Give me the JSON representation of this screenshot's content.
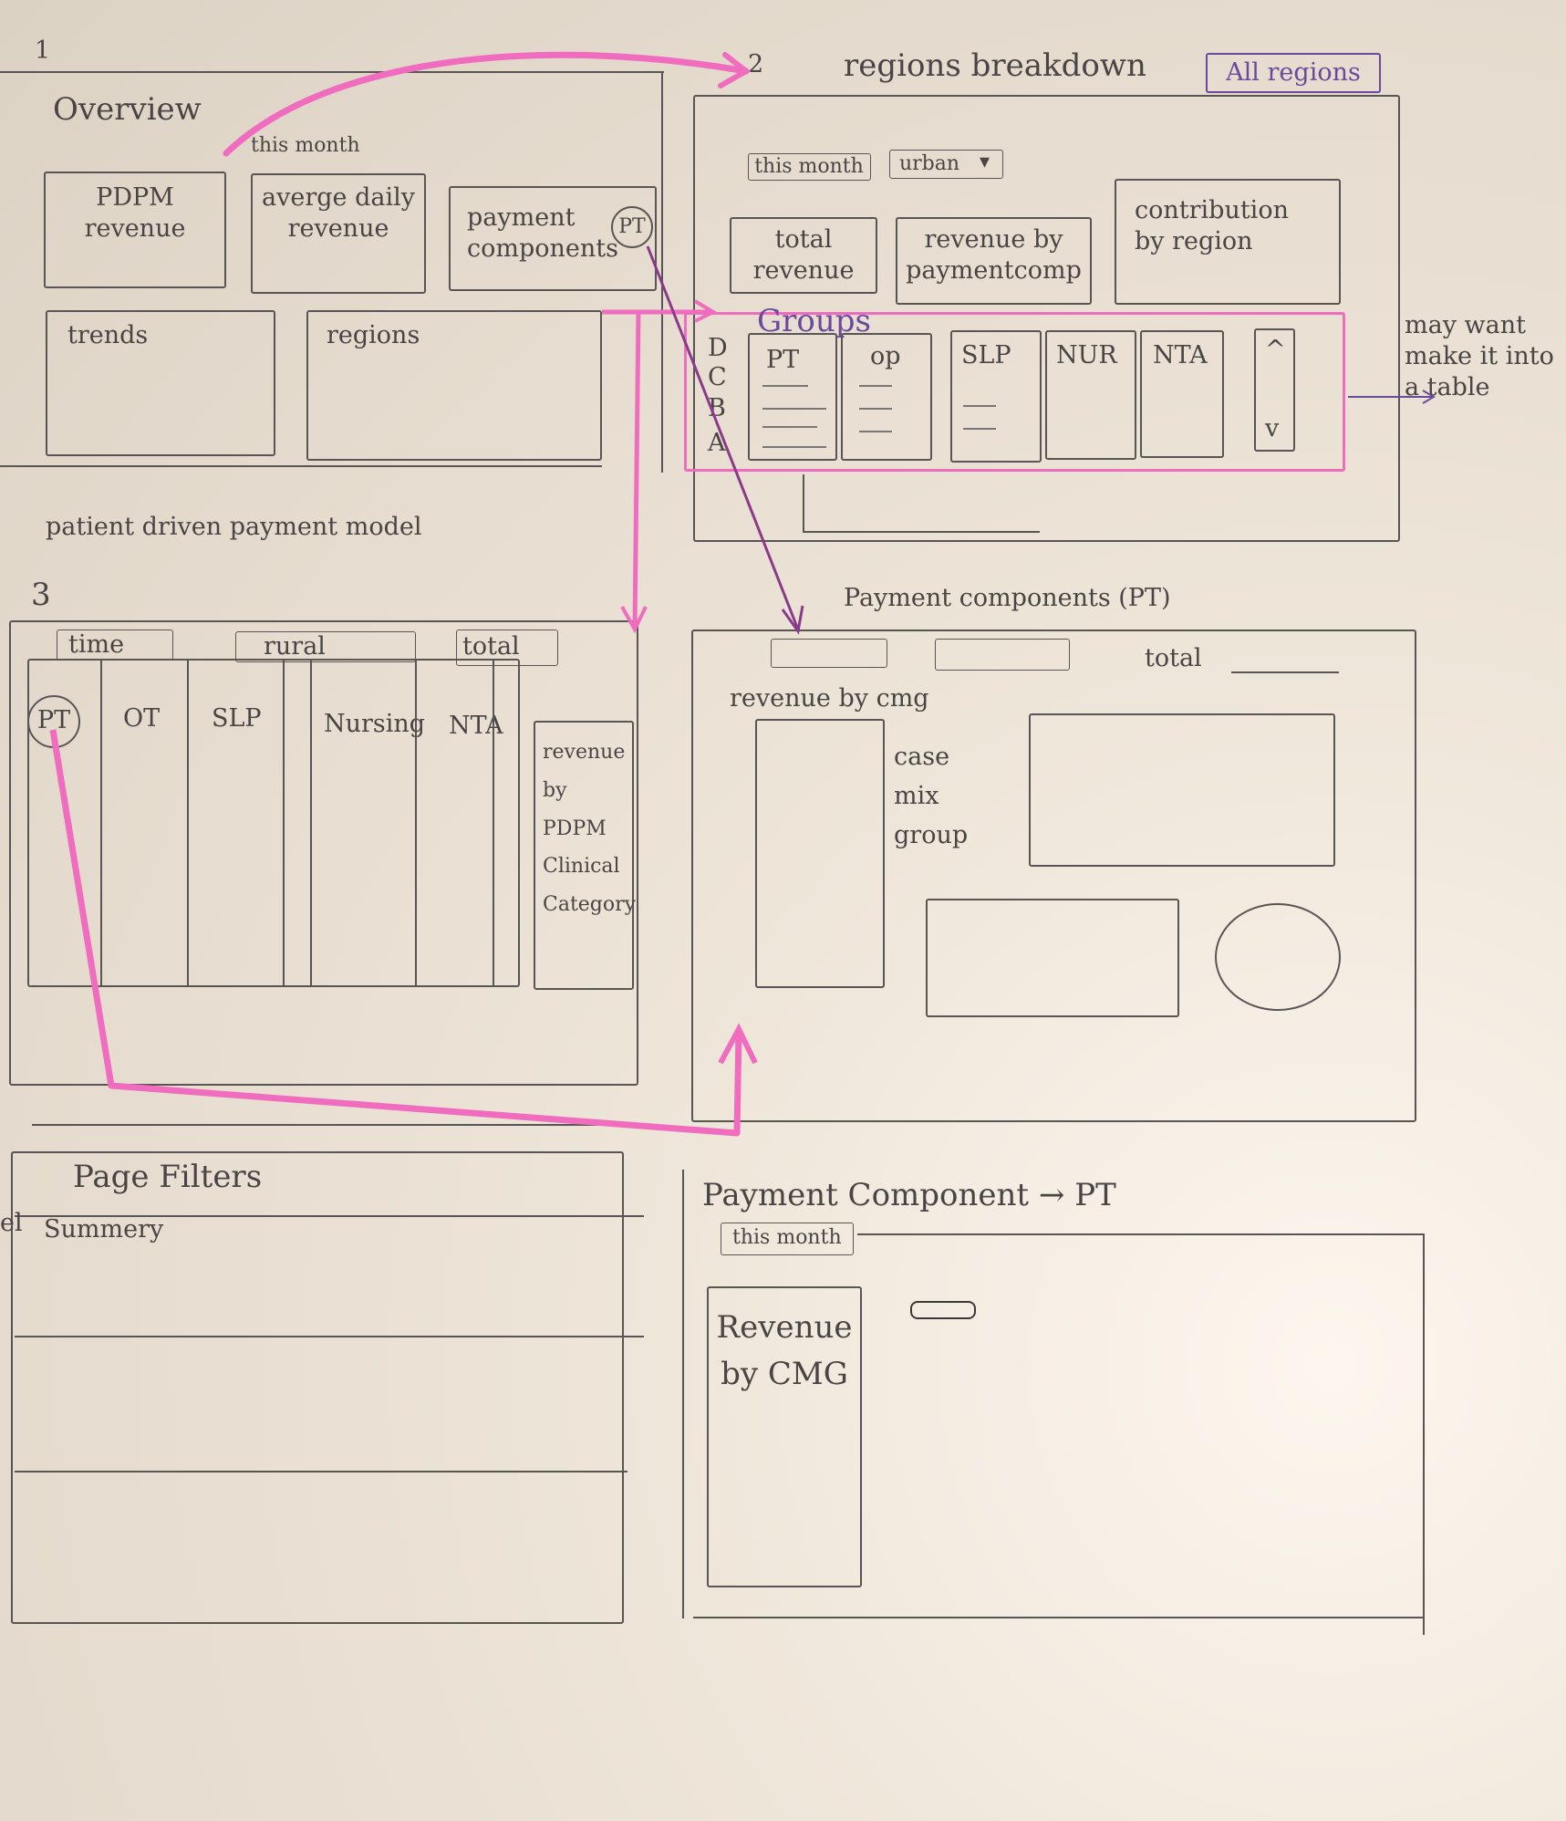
{
  "sketch": {
    "section1": {
      "number": "1",
      "title": "Overview",
      "period": "this month",
      "cards": {
        "pdpm": "PDPM revenue",
        "avg_daily": "averge daily revenue",
        "payment": "payment components",
        "payment_badge": "PT",
        "trends": "trends",
        "regions": "regions"
      },
      "caption": "patient driven payment model"
    },
    "section2": {
      "number": "2",
      "title": "regions breakdown",
      "region_button": "All regions",
      "filter_month": "this month",
      "filter_urban": "urban",
      "cards": {
        "total_revenue": "total revenue",
        "revenue_by_component": "revenue by paymentcomp",
        "contribution": "contribution by region"
      },
      "groups_label": "Groups",
      "row_labels": [
        "D",
        "C",
        "B",
        "A"
      ],
      "columns": [
        "PT",
        "op",
        "SLP",
        "NUR",
        "NTA"
      ],
      "note": "may want make it into a table"
    },
    "section3": {
      "number": "3",
      "filters": [
        "time",
        "rural",
        "total"
      ],
      "columns": [
        "PT",
        "OT",
        "SLP",
        "Nursing",
        "NTA"
      ],
      "side_label": "revenue by PDPM Clinical Category"
    },
    "section4": {
      "title": "Payment components (PT)",
      "total_label": "total",
      "revenue_label": "revenue by cmg",
      "group_label": "case mix group"
    },
    "section5": {
      "title": "Page Filters",
      "summary": "Summery",
      "edge_text": "el"
    },
    "section6": {
      "title": "Payment Component → PT",
      "filter_month": "this month",
      "revenue_card": "Revenue by CMG"
    },
    "colors": {
      "pencil": "#5a5555",
      "pink_highlighter": "#f06cbe",
      "purple_pen": "#6b4a9c",
      "paper": "#efe6da"
    }
  }
}
